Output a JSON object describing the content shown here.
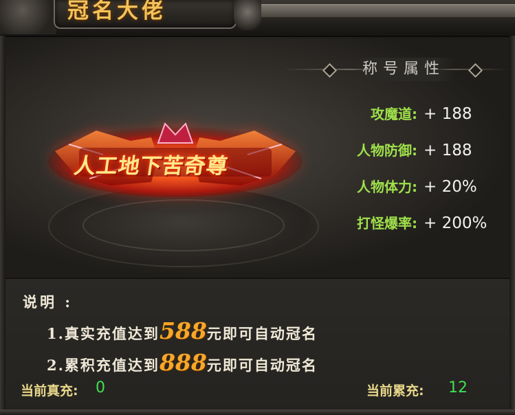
{
  "window": {
    "title": "冠名大佬"
  },
  "emblem": {
    "title_text": "人工地下苦奇尊"
  },
  "attributes": {
    "header": "称号属性",
    "rows": [
      {
        "label": "攻魔道:",
        "value": "+ 188"
      },
      {
        "label": "人物防御:",
        "value": "+ 188"
      },
      {
        "label": "人物体力:",
        "value": "+ 20%"
      },
      {
        "label": "打怪爆率:",
        "value": "+ 200%"
      }
    ]
  },
  "description": {
    "title": "说明 :",
    "lines": [
      {
        "prefix": "1.真实充值达到",
        "amount": "588",
        "suffix": "元即可自动冠名"
      },
      {
        "prefix": "2.累积充值达到",
        "amount": "888",
        "suffix": "元即可自动冠名"
      }
    ]
  },
  "footer": {
    "real_recharge_label": "当前真充:",
    "real_recharge_value": "0",
    "total_recharge_label": "当前累充:",
    "total_recharge_value": "12"
  },
  "colors": {
    "attribute_label": "#9fe04a",
    "amount_highlight": "#f7a728",
    "recharge_value": "#3fe052",
    "title_gold": "#f3c35a"
  }
}
